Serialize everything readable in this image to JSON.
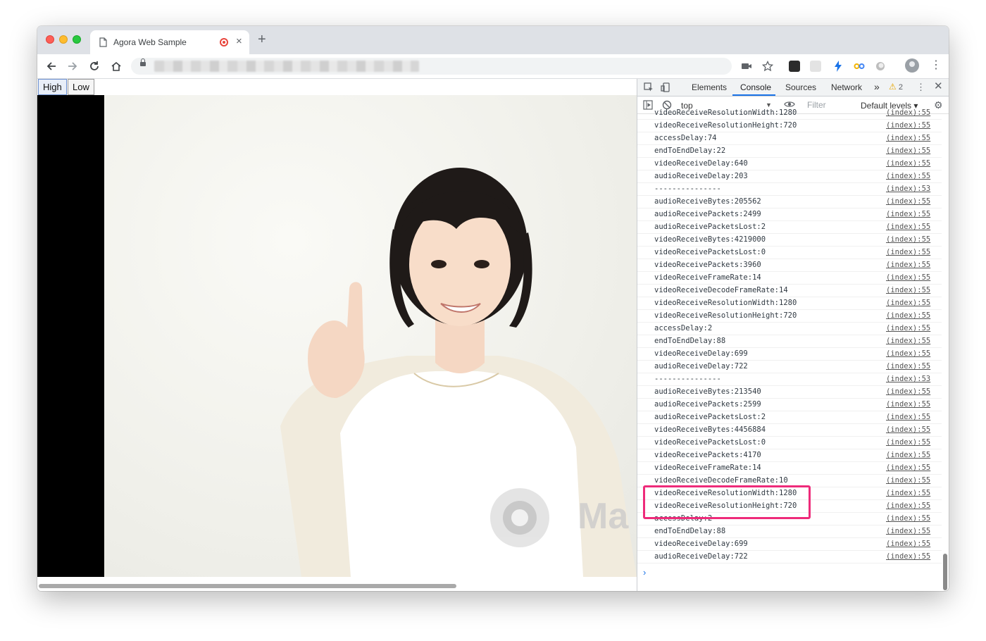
{
  "browser": {
    "tab_title": "Agora Web Sample",
    "tab_close": "×",
    "new_tab": "+"
  },
  "page": {
    "buttons": {
      "high": "High",
      "low": "Low"
    },
    "watermark_text": "Ma"
  },
  "devtools": {
    "tabs": [
      "Elements",
      "Console",
      "Sources",
      "Network"
    ],
    "active_tab": "Console",
    "more_tabs": "»",
    "warnings_count": "2",
    "context": "top",
    "filter_placeholder": "Filter",
    "levels": "Default levels ▾",
    "prompt": "›",
    "log": [
      {
        "msg": "videoReceiveResolutionWidth:1280",
        "src": "(index):55"
      },
      {
        "msg": "videoReceiveResolutionHeight:720",
        "src": "(index):55"
      },
      {
        "msg": "accessDelay:74",
        "src": "(index):55"
      },
      {
        "msg": "endToEndDelay:22",
        "src": "(index):55"
      },
      {
        "msg": "videoReceiveDelay:640",
        "src": "(index):55"
      },
      {
        "msg": "audioReceiveDelay:203",
        "src": "(index):55"
      },
      {
        "msg": "---------------",
        "src": "(index):53"
      },
      {
        "msg": "audioReceiveBytes:205562",
        "src": "(index):55"
      },
      {
        "msg": "audioReceivePackets:2499",
        "src": "(index):55"
      },
      {
        "msg": "audioReceivePacketsLost:2",
        "src": "(index):55"
      },
      {
        "msg": "videoReceiveBytes:4219000",
        "src": "(index):55"
      },
      {
        "msg": "videoReceivePacketsLost:0",
        "src": "(index):55"
      },
      {
        "msg": "videoReceivePackets:3960",
        "src": "(index):55"
      },
      {
        "msg": "videoReceiveFrameRate:14",
        "src": "(index):55"
      },
      {
        "msg": "videoReceiveDecodeFrameRate:14",
        "src": "(index):55"
      },
      {
        "msg": "videoReceiveResolutionWidth:1280",
        "src": "(index):55"
      },
      {
        "msg": "videoReceiveResolutionHeight:720",
        "src": "(index):55"
      },
      {
        "msg": "accessDelay:2",
        "src": "(index):55"
      },
      {
        "msg": "endToEndDelay:88",
        "src": "(index):55"
      },
      {
        "msg": "videoReceiveDelay:699",
        "src": "(index):55"
      },
      {
        "msg": "audioReceiveDelay:722",
        "src": "(index):55"
      },
      {
        "msg": "---------------",
        "src": "(index):53"
      },
      {
        "msg": "audioReceiveBytes:213540",
        "src": "(index):55"
      },
      {
        "msg": "audioReceivePackets:2599",
        "src": "(index):55"
      },
      {
        "msg": "audioReceivePacketsLost:2",
        "src": "(index):55"
      },
      {
        "msg": "videoReceiveBytes:4456884",
        "src": "(index):55"
      },
      {
        "msg": "videoReceivePacketsLost:0",
        "src": "(index):55"
      },
      {
        "msg": "videoReceivePackets:4170",
        "src": "(index):55"
      },
      {
        "msg": "videoReceiveFrameRate:14",
        "src": "(index):55"
      },
      {
        "msg": "videoReceiveDecodeFrameRate:10",
        "src": "(index):55"
      },
      {
        "msg": "videoReceiveResolutionWidth:1280",
        "src": "(index):55"
      },
      {
        "msg": "videoReceiveResolutionHeight:720",
        "src": "(index):55"
      },
      {
        "msg": "accessDelay:2",
        "src": "(index):55"
      },
      {
        "msg": "endToEndDelay:88",
        "src": "(index):55"
      },
      {
        "msg": "videoReceiveDelay:699",
        "src": "(index):55"
      },
      {
        "msg": "audioReceiveDelay:722",
        "src": "(index):55"
      }
    ]
  },
  "colors": {
    "highlight": "#ee2b7a",
    "devtools_accent": "#1a73e8"
  }
}
